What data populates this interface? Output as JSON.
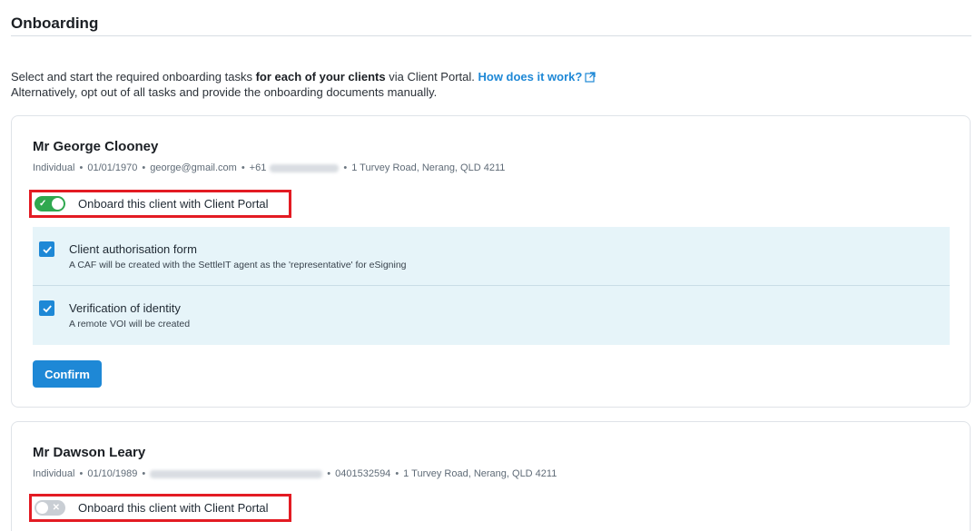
{
  "page": {
    "title": "Onboarding"
  },
  "intro": {
    "line1_prefix": "Select and start the required onboarding tasks ",
    "line1_bold": "for each of your clients",
    "line1_suffix": " via Client Portal. ",
    "help_link": "How does it work?",
    "line2": "Alternatively, opt out of all tasks and provide the onboarding documents manually."
  },
  "clients": [
    {
      "name": "Mr George Clooney",
      "type": "Individual",
      "dob": "01/01/1970",
      "email": "george@gmail.com",
      "phone_prefix": "+61",
      "address": "1 Turvey Road, Nerang, QLD 4211",
      "toggle_label": "Onboard this client with Client Portal",
      "toggle_on": true,
      "tasks": [
        {
          "title": "Client authorisation form",
          "description": "A CAF will be created with the SettleIT agent as the 'representative' for eSigning",
          "checked": true
        },
        {
          "title": "Verification of identity",
          "description": "A remote VOI will be created",
          "checked": true
        }
      ],
      "confirm_label": "Confirm"
    },
    {
      "name": "Mr Dawson Leary",
      "type": "Individual",
      "dob": "01/10/1989",
      "phone": "0401532594",
      "address": "1 Turvey Road, Nerang, QLD 4211",
      "toggle_label": "Onboard this client with Client Portal",
      "toggle_on": false
    }
  ],
  "colors": {
    "accent": "#1e88d6",
    "toggle_on": "#2fa84f",
    "toggle_off": "#c9ced4",
    "task_bg": "#e6f4f9",
    "highlight_border": "#e31b23"
  },
  "icons": {
    "external_link": "external-link-icon",
    "checkmark": "check-icon",
    "toggle_x": "x-icon"
  }
}
